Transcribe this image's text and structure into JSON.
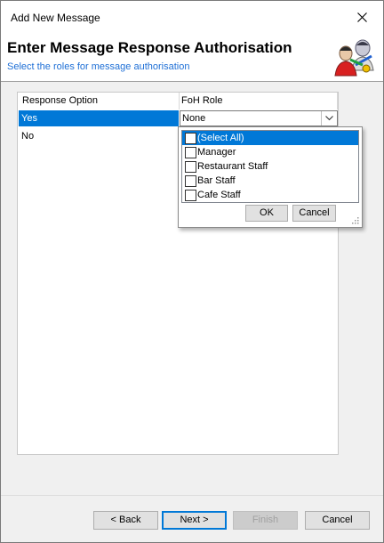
{
  "window": {
    "title": "Add New Message"
  },
  "header": {
    "title": "Enter Message Response Authorisation",
    "subtitle": "Select the roles for message authorisation"
  },
  "grid": {
    "columns": [
      "Response Option",
      "FoH Role"
    ],
    "rows": [
      {
        "option": "Yes",
        "role": "None",
        "selected": true
      },
      {
        "option": "No",
        "role": ""
      }
    ]
  },
  "dropdown": {
    "items": [
      {
        "label": "(Select All)",
        "checked": false,
        "highlighted": true
      },
      {
        "label": "Manager",
        "checked": false
      },
      {
        "label": "Restaurant Staff",
        "checked": false
      },
      {
        "label": "Bar Staff",
        "checked": false
      },
      {
        "label": "Cafe Staff",
        "checked": false
      }
    ],
    "ok_label": "OK",
    "cancel_label": "Cancel"
  },
  "footer": {
    "back_label": "< Back",
    "next_label": "Next >",
    "finish_label": "Finish",
    "cancel_label": "Cancel"
  },
  "colors": {
    "selection": "#0078d7",
    "link_blue": "#1e6fd6"
  }
}
